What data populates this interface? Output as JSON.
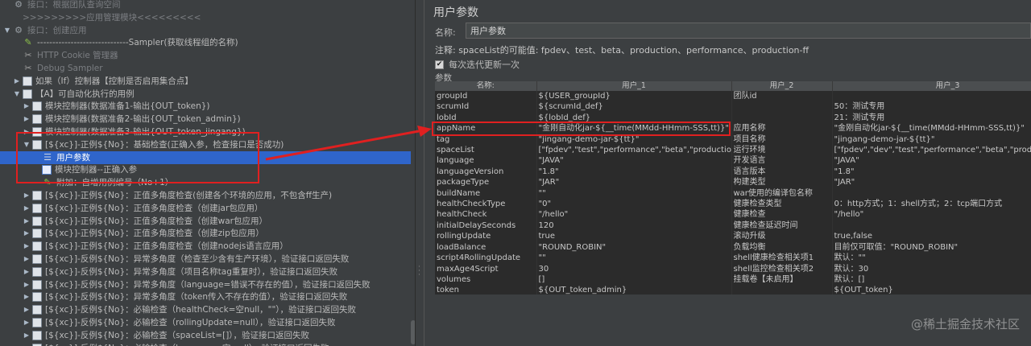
{
  "tree": {
    "rows": [
      {
        "indent": 0,
        "arrow": "",
        "icon": "gear",
        "label": "接口：根据团队查询空间",
        "dim": true
      },
      {
        "indent": 1,
        "arrow": "",
        "icon": "none",
        "label": ">>>>>>>>>应用管理模块<<<<<<<<<",
        "dim": true
      },
      {
        "indent": 0,
        "arrow": "▼",
        "icon": "gear",
        "label": "接口：创建应用",
        "dim": true
      },
      {
        "indent": 1,
        "arrow": "",
        "icon": "pen",
        "label": "------------------------------Sampler(获取线程组的名称)",
        "dim": false
      },
      {
        "indent": 1,
        "arrow": "",
        "icon": "tool",
        "label": "HTTP Cookie 管理器",
        "dim": true
      },
      {
        "indent": 1,
        "arrow": "",
        "icon": "tool",
        "label": "Debug Sampler",
        "dim": true
      },
      {
        "indent": 1,
        "arrow": "▶",
        "icon": "ctrl",
        "label": "如果（If）控制器【控制是否启用集合点】",
        "dim": false
      },
      {
        "indent": 1,
        "arrow": "▼",
        "icon": "ctrl",
        "label": "【A】可自动化执行的用例",
        "dim": false
      },
      {
        "indent": 2,
        "arrow": "▶",
        "icon": "ctrl",
        "label": "模块控制器(数据准备1-输出{OUT_token})",
        "dim": false
      },
      {
        "indent": 2,
        "arrow": "▶",
        "icon": "ctrl",
        "label": "模块控制器(数据准备2-输出{OUT_token_admin})",
        "dim": false
      },
      {
        "indent": 2,
        "arrow": "▶",
        "icon": "ctrl",
        "label": "模块控制器(数据准备3-输出{OUT_token_jingang})",
        "dim": false
      },
      {
        "indent": 2,
        "arrow": "▼",
        "icon": "ctrl",
        "label": "[${xc}]-正例${No}：基础检查(正确入参，检查接口是否成功)",
        "dim": false
      },
      {
        "indent": 3,
        "arrow": "",
        "icon": "user",
        "label": "用户参数",
        "dim": false,
        "selected": true
      },
      {
        "indent": 3,
        "arrow": "",
        "icon": "ctrlblue",
        "label": "模块控制器--正确入参",
        "dim": false
      },
      {
        "indent": 3,
        "arrow": "",
        "icon": "pen",
        "label": "附加：自增用例编号（No+1）",
        "dim": false
      },
      {
        "indent": 2,
        "arrow": "▶",
        "icon": "ctrl",
        "label": "[${xc}]-正例${No}：正值多角度检查(创建各个环境的应用，不包含ff生产)",
        "dim": false
      },
      {
        "indent": 2,
        "arrow": "▶",
        "icon": "ctrl",
        "label": "[${xc}]-正例${No}：正值多角度检查（创建jar包应用）",
        "dim": false
      },
      {
        "indent": 2,
        "arrow": "▶",
        "icon": "ctrl",
        "label": "[${xc}]-正例${No}：正值多角度检查（创建war包应用）",
        "dim": false
      },
      {
        "indent": 2,
        "arrow": "▶",
        "icon": "ctrl",
        "label": "[${xc}]-正例${No}：正值多角度检查（创建zip包应用）",
        "dim": false
      },
      {
        "indent": 2,
        "arrow": "▶",
        "icon": "ctrl",
        "label": "[${xc}]-正例${No}：正值多角度检查（创建nodejs语言应用）",
        "dim": false
      },
      {
        "indent": 2,
        "arrow": "▶",
        "icon": "ctrl",
        "label": "[${xc}]-反例${No}：异常多角度（检查至少含有生产环境），验证接口返回失败",
        "dim": false
      },
      {
        "indent": 2,
        "arrow": "▶",
        "icon": "ctrl",
        "label": "[${xc}]-反例${No}：异常多角度（项目名称tag重复时），验证接口返回失败",
        "dim": false
      },
      {
        "indent": 2,
        "arrow": "▶",
        "icon": "ctrl",
        "label": "[${xc}]-反例${No}：异常多角度（language=错误不存在的值），验证接口返回失败",
        "dim": false
      },
      {
        "indent": 2,
        "arrow": "▶",
        "icon": "ctrl",
        "label": "[${xc}]-反例${No}：异常多角度（token传入不存在的值），验证接口返回失败",
        "dim": false
      },
      {
        "indent": 2,
        "arrow": "▶",
        "icon": "ctrl",
        "label": "[${xc}]-反例${No}：必输检查（healthCheck=空null，\"\"），验证接口返回失败",
        "dim": false
      },
      {
        "indent": 2,
        "arrow": "▶",
        "icon": "ctrl",
        "label": "[${xc}]-反例${No}：必输检查（rollingUpdate=null），验证接口返回失败",
        "dim": false
      },
      {
        "indent": 2,
        "arrow": "▶",
        "icon": "ctrl",
        "label": "[${xc}]-反例${No}：必输检查（spaceList=[]），验证接口返回失败",
        "dim": false
      },
      {
        "indent": 2,
        "arrow": "▶",
        "icon": "ctrl",
        "label": "[${xc}]-反例${No}：必输检查（language=空 null），验证接口返回失败",
        "dim": false
      }
    ]
  },
  "panel": {
    "title": "用户参数",
    "name_label": "名称:",
    "name_value": "用户参数",
    "note": "注释: spaceList的可能值: fpdev、test、beta、production、performance、production-ff",
    "each_iteration_label": "每次迭代更新一次",
    "each_iteration_checked": true,
    "params_label": "参数"
  },
  "grid": {
    "headers": [
      "名称:",
      "用户_1",
      "用户_2",
      "用户_3"
    ],
    "rows": [
      [
        "groupId",
        "${USER_groupId}",
        "团队id",
        ""
      ],
      [
        "scrumId",
        "${scrumId_def}",
        "",
        "50：测试专用"
      ],
      [
        "lobId",
        "${lobId_def}",
        "",
        "21：测试专用"
      ],
      [
        "appName",
        "\"金刚自动化jar-${__time(MMdd-HHmm-SSS,tt)}\"",
        "应用名称",
        "\"金刚自动化jar-${__time(MMdd-HHmm-SSS,tt)}\""
      ],
      [
        "tag",
        "\"jingang-demo-jar-${tt}\"",
        "项目名称",
        "\"jingang-demo-jar-${tt}\""
      ],
      [
        "spaceList",
        "[\"fpdev\",\"test\",\"performance\",\"beta\",\"production\"]",
        "运行环境",
        "[\"fpdev\",\"dev\",\"test\",\"performance\",\"beta\",\"production\"]"
      ],
      [
        "language",
        "\"JAVA\"",
        "开发语言",
        "\"JAVA\""
      ],
      [
        "languageVersion",
        "\"1.8\"",
        "语言版本",
        "\"1.8\""
      ],
      [
        "packageType",
        "\"JAR\"",
        "构建类型",
        "\"JAR\""
      ],
      [
        "buildName",
        "\"\"",
        "war使用的编译包名称",
        ""
      ],
      [
        "healthCheckType",
        "\"0\"",
        "健康检查类型",
        "0：http方式；1：shell方式；2：tcp端口方式"
      ],
      [
        "healthCheck",
        "\"/hello\"",
        "健康检查",
        "\"/hello\""
      ],
      [
        "initialDelaySeconds",
        "120",
        "健康检查延迟时间",
        ""
      ],
      [
        "rollingUpdate",
        "true",
        "滚动升级",
        "true,false"
      ],
      [
        "loadBalance",
        "\"ROUND_ROBIN\"",
        "负载均衡",
        "目前仅可取值：\"ROUND_ROBIN\""
      ],
      [
        "script4RollingUpdate",
        "\"\"",
        "shell健康检查相关项1",
        "默认：\"\""
      ],
      [
        "maxAge4Script",
        "30",
        "shell监控检查相关项2",
        "默认：30"
      ],
      [
        "volumes",
        "[]",
        "挂载卷【未启用】",
        "默认：[]"
      ],
      [
        "token",
        "${OUT_token_admin}",
        "",
        "${OUT_token}"
      ]
    ]
  },
  "watermark": "@稀土掘金技术社区",
  "colors": {
    "background": "#3c3f41",
    "selection": "#2f65ca",
    "highlight_red": "#e02020"
  }
}
